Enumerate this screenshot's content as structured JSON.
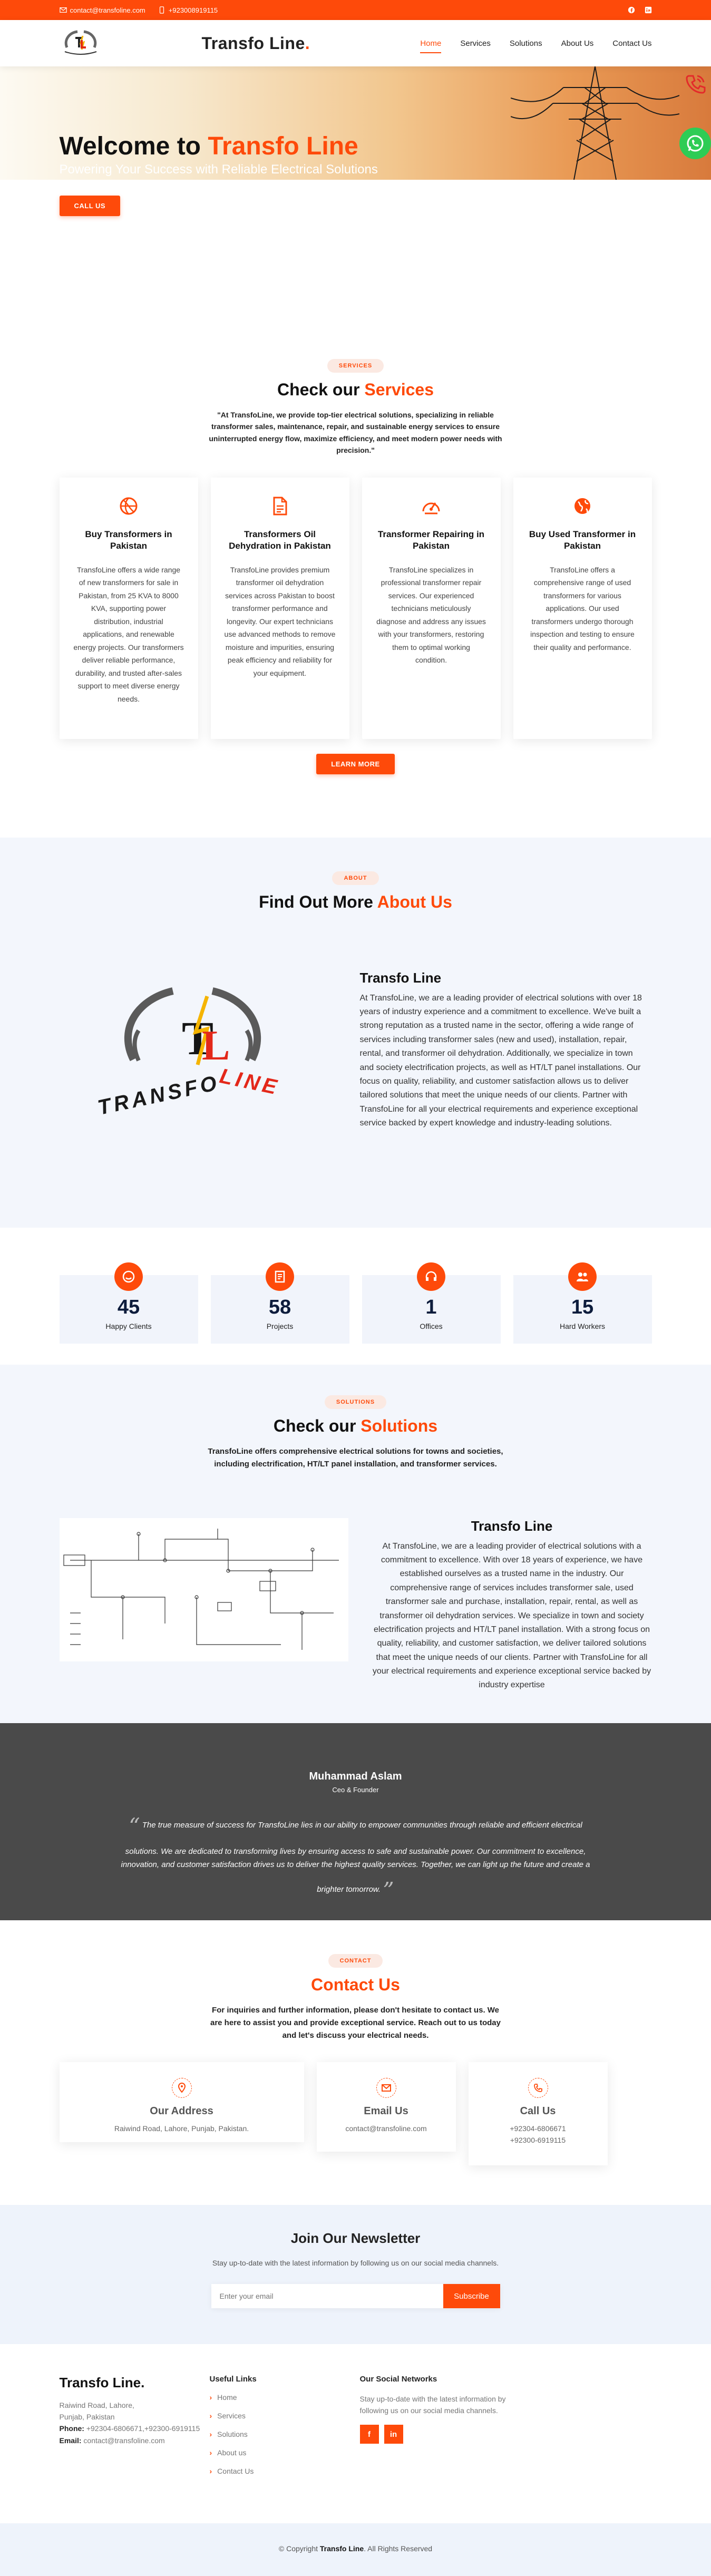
{
  "topbar": {
    "email": "contact@transfoline.com",
    "phone": "+923008919115",
    "social_icons": [
      "facebook-icon",
      "linkedin-icon"
    ]
  },
  "header": {
    "brand": "Transfo Line",
    "brand_dot": ".",
    "nav": [
      "Home",
      "Services",
      "Solutions",
      "About Us",
      "Contact Us"
    ],
    "active": "Home"
  },
  "hero": {
    "title_prefix": "Welcome to ",
    "title_accent": "Transfo Line",
    "subtitle": "Powering Your Success with Reliable Electrical Solutions",
    "cta": "CALL US"
  },
  "colors": {
    "accent": "#fe4a0a",
    "dark": "#111111",
    "light_bg": "#f3f6fc",
    "testimonial_bg": "#4a4a4a"
  },
  "services": {
    "pill": "SERVICES",
    "title_prefix": "Check our ",
    "title_accent": "Services",
    "lead": "\"At TransfoLine, we provide top-tier electrical solutions, specializing in reliable transformer sales, maintenance, repair, and sustainable energy services to ensure uninterrupted energy flow, maximize efficiency, and meet modern power needs with precision.\"",
    "cards": [
      {
        "icon": "basketball-icon",
        "title": "Buy Transformers in Pakistan",
        "text": "TransfoLine offers a wide range of new transformers for sale in Pakistan, from 25 KVA to 8000 KVA, supporting power distribution, industrial applications, and renewable energy projects. Our transformers deliver reliable performance, durability, and trusted after-sales support to meet diverse energy needs."
      },
      {
        "icon": "document-icon",
        "title": "Transformers Oil Dehydration in Pakistan",
        "text": "TransfoLine provides premium transformer oil dehydration services across Pakistan to boost transformer performance and longevity. Our expert technicians use advanced methods to remove moisture and impurities, ensuring peak efficiency and reliability for your equipment."
      },
      {
        "icon": "speedometer-icon",
        "title": "Transformer Repairing in Pakistan",
        "text": "TransfoLine specializes in professional transformer repair services. Our experienced technicians meticulously diagnose and address any issues with your transformers, restoring them to optimal working condition."
      },
      {
        "icon": "globe-icon",
        "title": "Buy Used Transformer in Pakistan",
        "text": "TransfoLine offers a comprehensive range of used transformers for various applications. Our used transformers undergo thorough inspection and testing to ensure their quality and performance."
      }
    ],
    "learn_more": "LEARN MORE"
  },
  "about": {
    "pill": "ABOUT",
    "title_prefix": "Find Out More ",
    "title_accent": "About Us",
    "logo_word_1": "TRANSFO",
    "logo_word_2": "LINE",
    "logo_letter_t": "T",
    "logo_letter_l": "L",
    "heading": "Transfo Line",
    "text": "At TransfoLine, we are a leading provider of electrical solutions with over 18 years of industry experience and a commitment to excellence. We've built a strong reputation as a trusted name in the sector, offering a wide range of services including transformer sales (new and used), installation, repair, rental, and transformer oil dehydration. Additionally, we specialize in town and society electrification projects, as well as HT/LT panel installations. Our focus on quality, reliability, and customer satisfaction allows us to deliver tailored solutions that meet the unique needs of our clients. Partner with TransfoLine for all your electrical requirements and experience exceptional service backed by expert knowledge and industry-leading solutions."
  },
  "stats": [
    {
      "icon": "smile-icon",
      "value": "45",
      "label": "Happy Clients"
    },
    {
      "icon": "journal-icon",
      "value": "58",
      "label": "Projects"
    },
    {
      "icon": "headset-icon",
      "value": "1",
      "label": "Offices"
    },
    {
      "icon": "people-icon",
      "value": "15",
      "label": "Hard Workers"
    }
  ],
  "solutions": {
    "pill": "SOLUTIONS",
    "title_prefix": "Check our ",
    "title_accent": "Solutions",
    "lead": "TransfoLine offers comprehensive electrical solutions for towns and societies, including electrification, HT/LT panel installation, and transformer services.",
    "heading": "Transfo Line",
    "text": "At TransfoLine, we are a leading provider of electrical solutions with a commitment to excellence. With over 18 years of experience, we have established ourselves as a trusted name in the industry. Our comprehensive range of services includes transformer sale, used transformer sale and purchase, installation, repair, rental, as well as transformer oil dehydration services. We specialize in town and society electrification projects and HT/LT panel installation. With a strong focus on quality, reliability, and customer satisfaction, we deliver tailored solutions that meet the unique needs of our clients. Partner with TransfoLine for all your electrical requirements and experience exceptional service backed by industry expertise"
  },
  "testimonial": {
    "name": "Muhammad Aslam",
    "role": "Ceo & Founder",
    "quote": "The true measure of success for TransfoLine lies in our ability to empower communities through reliable and efficient electrical solutions. We are dedicated to transforming lives by ensuring access to safe and sustainable power. Our commitment to excellence, innovation, and customer satisfaction drives us to deliver the highest quality services. Together, we can light up the future and create a brighter tomorrow."
  },
  "contact": {
    "pill": "CONTACT",
    "title": "Contact Us",
    "lead": "For inquiries and further information, please don't hesitate to contact us. We are here to assist you and provide exceptional service. Reach out to us today and let's discuss your electrical needs.",
    "cards": [
      {
        "icon": "map-pin-icon",
        "title": "Our Address",
        "lines": [
          "Raiwind Road, Lahore, Punjab, Pakistan."
        ]
      },
      {
        "icon": "envelope-icon",
        "title": "Email Us",
        "lines": [
          "contact@transfoline.com"
        ]
      },
      {
        "icon": "phone-icon",
        "title": "Call Us",
        "lines": [
          "+92304-6806671",
          "+92300-6919115"
        ]
      }
    ]
  },
  "newsletter": {
    "title": "Join Our Newsletter",
    "text": "Stay up-to-date with the latest information by following us on our social media channels.",
    "placeholder": "Enter your email",
    "button": "Subscribe"
  },
  "footer": {
    "brand": "Transfo Line.",
    "address_1": "Raiwind Road, Lahore,",
    "address_2": "Punjab, Pakistan",
    "phone_label": "Phone:",
    "phone": " +92304-6806671,+92300-6919115",
    "email_label": "Email:",
    "email": " contact@transfoline.com",
    "links_title": "Useful Links",
    "links": [
      "Home",
      "Services",
      "Solutions",
      "About us",
      "Contact Us"
    ],
    "social_title": "Our Social Networks",
    "social_text": "Stay up-to-date with the latest information by following us on our social media channels.",
    "social_buttons": [
      "f",
      "in"
    ]
  },
  "copyright": {
    "prefix": "© Copyright ",
    "brand": "Transfo Line",
    "suffix": ". All Rights Reserved"
  }
}
